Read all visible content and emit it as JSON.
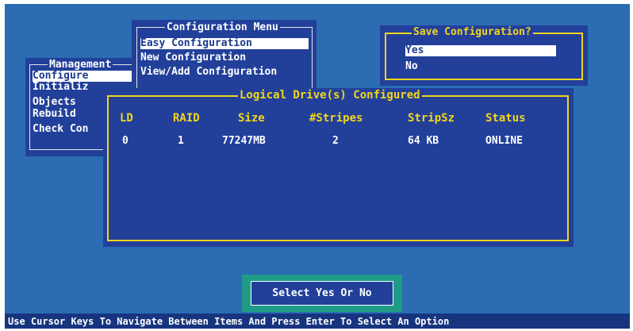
{
  "management_menu": {
    "title": "Management",
    "items": [
      "Configure",
      "Initializ",
      "Objects",
      "Rebuild",
      "Check Con"
    ],
    "selected_index": 0
  },
  "configuration_menu": {
    "title": "Configuration Menu",
    "items": [
      "Easy Configuration",
      "New Configuration",
      "View/Add Configuration"
    ],
    "selected_index": 0
  },
  "save_dialog": {
    "title": "Save Configuration?",
    "options": [
      "Yes",
      "No"
    ],
    "selected_index": 0
  },
  "logical_drives": {
    "title": "Logical Drive(s) Configured",
    "columns": [
      "LD",
      "RAID",
      "Size",
      "#Stripes",
      "StripSz",
      "Status"
    ],
    "rows": [
      [
        "0",
        "1",
        "77247MB",
        "2",
        "64 KB",
        "ONLINE"
      ]
    ]
  },
  "prompt": {
    "text": "Select Yes Or No"
  },
  "status_bar": {
    "text": "Use Cursor Keys To Navigate Between Items And Press Enter To Select An Option"
  },
  "colors": {
    "screen_bg": "#2b6cb3",
    "panel_bg": "#22409a",
    "highlight_text": "#f2d51c",
    "prompt_bg": "#1f9c85",
    "status_bg": "#17347e"
  }
}
